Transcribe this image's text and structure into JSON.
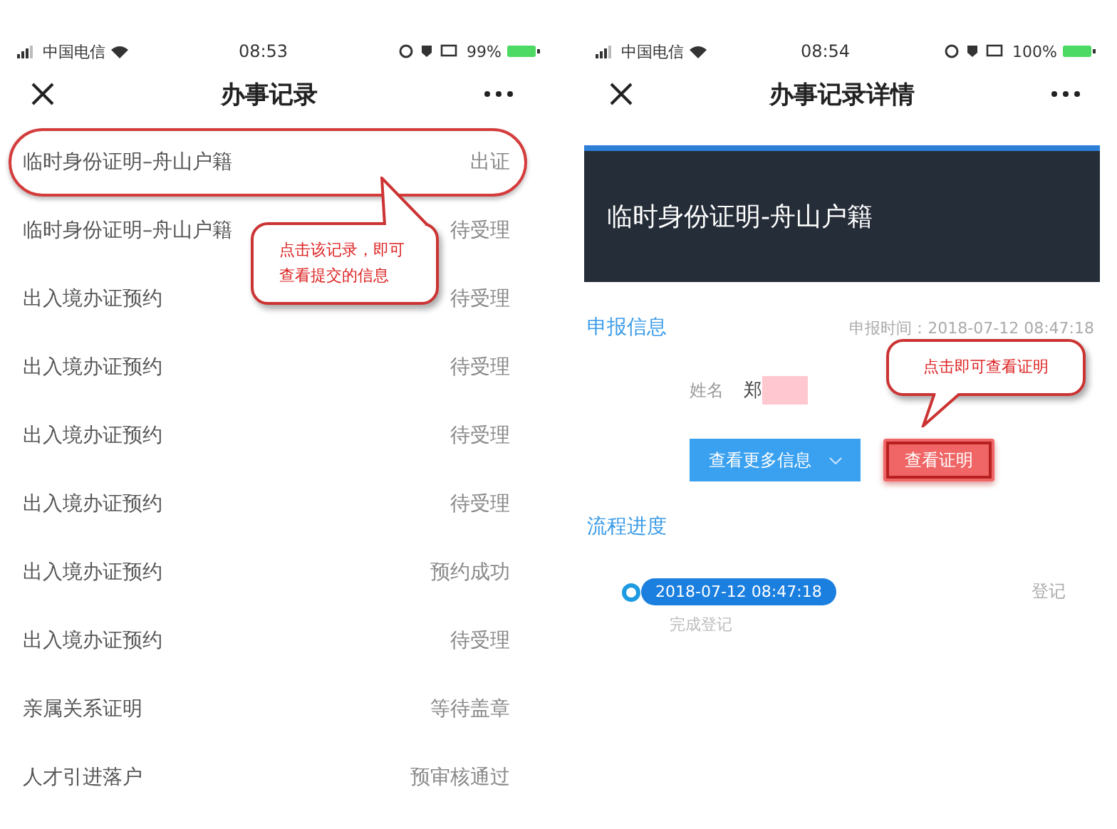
{
  "left_phone": {
    "status_bar": {
      "carrier": "中国电信",
      "time": "08:53",
      "battery": "99%"
    },
    "title": "办事记录",
    "records": [
      {
        "name": "临时身份证明–舟山户籍",
        "status": "出证",
        "circled": true
      },
      {
        "name": "临时身份证明–舟山户籍",
        "status": "待受理",
        "circled": false
      },
      {
        "name": "出入境办证预约",
        "status": "待受理",
        "circled": false
      },
      {
        "name": "出入境办证预约",
        "status": "待受理",
        "circled": false
      },
      {
        "name": "出入境办证预约",
        "status": "待受理",
        "circled": false
      },
      {
        "name": "出入境办证预约",
        "status": "待受理",
        "circled": false
      },
      {
        "name": "出入境办证预约",
        "status": "预约成功",
        "circled": false
      },
      {
        "name": "出入境办证预约",
        "status": "待受理",
        "circled": false
      },
      {
        "name": "亲属关系证明",
        "status": "等待盖章",
        "circled": false
      },
      {
        "name": "人才引进落户",
        "status": "预审核通过",
        "circled": false
      }
    ],
    "callout": "点击该记录，即可查看提交的信息"
  },
  "right_phone": {
    "status_bar": {
      "carrier": "中国电信",
      "time": "08:54",
      "battery": "100%"
    },
    "title": "办事记录详情",
    "banner": "临时身份证明-舟山户籍",
    "section_title": "申报信息",
    "submit_time": "申报时间：2018-07-12 08:47:18",
    "name_label": "姓名",
    "name_value": "郑",
    "buttons": [
      {
        "label": "查看更多信息",
        "kind": "dropdown",
        "circled": false
      },
      {
        "label": "查看证明",
        "kind": "danger",
        "circled": true
      }
    ],
    "callout": "点击即可查看证明",
    "progress_title": "流程进度",
    "timeline": [
      {
        "time": "2018-07-12 08:47:18",
        "note": "完成登记",
        "step": "登记"
      }
    ]
  }
}
